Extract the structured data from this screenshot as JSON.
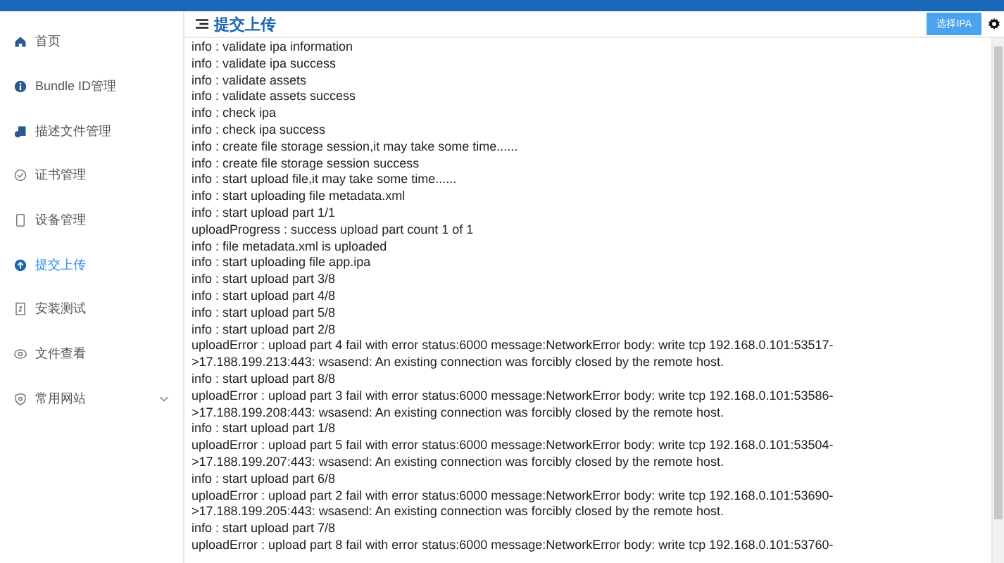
{
  "sidebar": {
    "items": [
      {
        "label": "首页",
        "selected": false
      },
      {
        "label": "Bundle ID管理",
        "selected": false
      },
      {
        "label": "描述文件管理",
        "selected": false
      },
      {
        "label": "证书管理",
        "selected": false
      },
      {
        "label": "设备管理",
        "selected": false
      },
      {
        "label": "提交上传",
        "selected": true
      },
      {
        "label": "安装测试",
        "selected": false
      },
      {
        "label": "文件查看",
        "selected": false
      },
      {
        "label": "常用网站",
        "selected": false,
        "expandable": true
      }
    ]
  },
  "header": {
    "title": "提交上传",
    "button": "选择IPA"
  },
  "log": [
    "info : validate ipa information",
    "info : validate ipa success",
    "info : validate assets",
    "info : validate assets success",
    "info : check ipa",
    "info : check ipa success",
    "info : create file storage session,it may take some time......",
    "info : create file storage session success",
    "info : start upload file,it may take some time......",
    "info : start uploading file metadata.xml",
    "info : start upload part 1/1",
    "uploadProgress : success upload part count 1 of 1",
    "info : file metadata.xml is uploaded",
    "info : start uploading file app.ipa",
    "info : start upload part 3/8",
    "info : start upload part 4/8",
    "info : start upload part 5/8",
    "info : start upload part 2/8",
    "uploadError : upload part 4 fail with error status:6000 message:NetworkError body: write tcp 192.168.0.101:53517-",
    ">17.188.199.213:443: wsasend: An existing connection was forcibly closed by the remote host.",
    "info : start upload part 8/8",
    "uploadError : upload part 3 fail with error status:6000 message:NetworkError body: write tcp 192.168.0.101:53586-",
    ">17.188.199.208:443: wsasend: An existing connection was forcibly closed by the remote host.",
    "info : start upload part 1/8",
    "uploadError : upload part 5 fail with error status:6000 message:NetworkError body: write tcp 192.168.0.101:53504-",
    ">17.188.199.207:443: wsasend: An existing connection was forcibly closed by the remote host.",
    "info : start upload part 6/8",
    "uploadError : upload part 2 fail with error status:6000 message:NetworkError body: write tcp 192.168.0.101:53690-",
    ">17.188.199.205:443: wsasend: An existing connection was forcibly closed by the remote host.",
    "info : start upload part 7/8",
    "uploadError : upload part 8 fail with error status:6000 message:NetworkError body: write tcp 192.168.0.101:53760-"
  ]
}
